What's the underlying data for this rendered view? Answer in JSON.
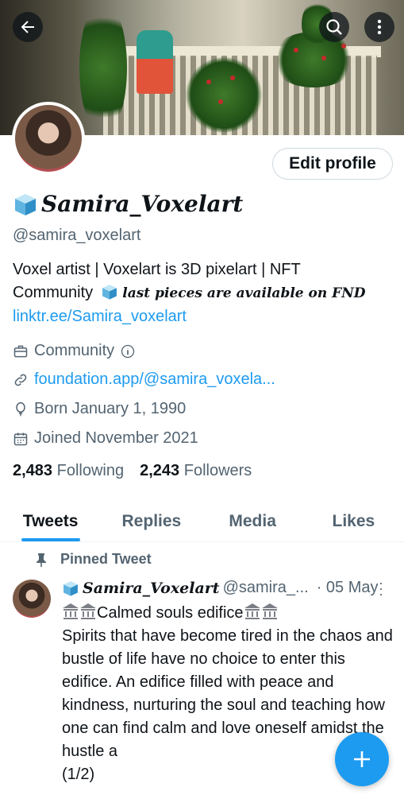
{
  "header": {
    "back_icon": "arrow-left-icon",
    "search_icon": "search-icon",
    "more_icon": "more-vertical-icon"
  },
  "profile": {
    "edit_label": "Edit profile",
    "display_name": "Samira_Voxelart",
    "handle": "@samira_voxelart",
    "bio_line1": "Voxel artist | Voxelart is 3D pixelart | NFT",
    "bio_line2_plain": "Community",
    "bio_line2_italic": "last pieces are available on FND",
    "bio_link": "linktr.ee/Samira_voxelart",
    "category": "Community",
    "website": "foundation.app/@samira_voxela...",
    "born": "Born January 1, 1990",
    "joined": "Joined November 2021",
    "following_count": "2,483",
    "following_label": "Following",
    "followers_count": "2,243",
    "followers_label": "Followers"
  },
  "tabs": [
    {
      "label": "Tweets"
    },
    {
      "label": "Replies"
    },
    {
      "label": "Media"
    },
    {
      "label": "Likes"
    }
  ],
  "pinned_tweet": {
    "pinned_label": "Pinned Tweet",
    "name": "Samira_Voxelart",
    "handle": "@samira_...",
    "date": "· 05 May",
    "first_line": "Calmed souls edifice",
    "body": "\nSpirits that have become tired in the chaos and bustle of life have no choice to enter this edifice. An edifice filled with peace and kindness, nurturing the soul and teaching how one can find calm and love oneself amidst the hustle a\n(1/2)"
  },
  "colors": {
    "accent": "#1d9bf0",
    "text": "#0f1419",
    "secondary": "#536471"
  }
}
